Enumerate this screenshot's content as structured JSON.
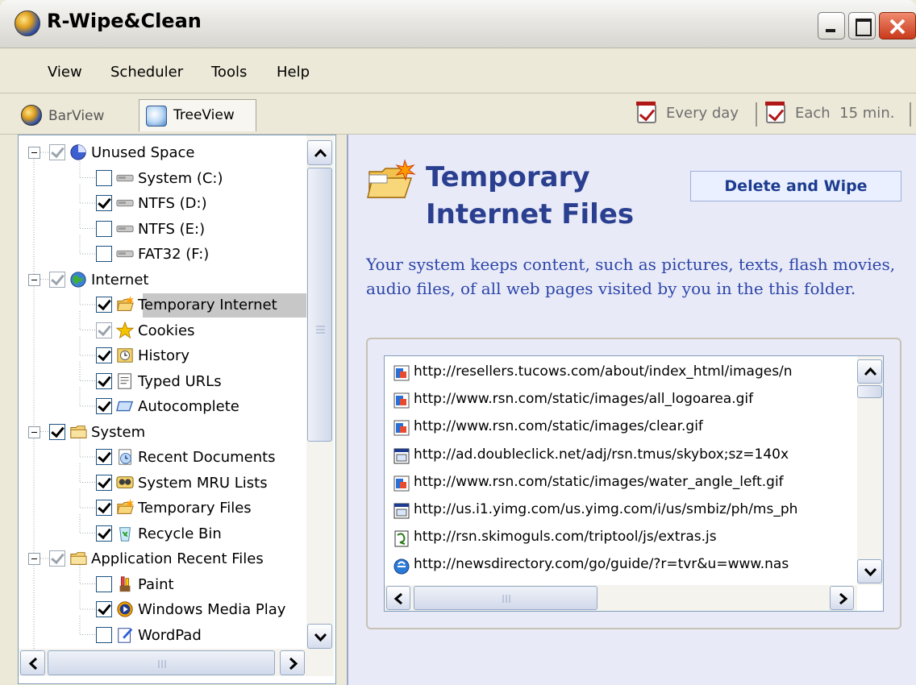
{
  "window": {
    "title": "R-Wipe&Clean"
  },
  "menu": [
    "View",
    "Scheduler",
    "Tools",
    "Help"
  ],
  "toolbar": {
    "tabs": [
      {
        "label": "BarView",
        "icon": "globe-icon",
        "active": false
      },
      {
        "label": "TreeView",
        "icon": "tree-view-icon",
        "active": true
      }
    ],
    "schedule": [
      {
        "label": "Every day",
        "icon": "calendar-check-icon"
      },
      {
        "label": "Each  15 min.",
        "icon": "calendar-check-icon"
      }
    ]
  },
  "tree": [
    {
      "label": "Unused Space",
      "level": 0,
      "checked": "partial",
      "icon": "disk-space-icon",
      "expander": true
    },
    {
      "label": "System (C:)",
      "level": 1,
      "checked": "unchecked",
      "icon": "drive-icon"
    },
    {
      "label": "NTFS (D:)",
      "level": 1,
      "checked": "checked",
      "icon": "drive-icon"
    },
    {
      "label": "NTFS (E:)",
      "level": 1,
      "checked": "unchecked",
      "icon": "drive-icon"
    },
    {
      "label": "FAT32 (F:)",
      "level": 1,
      "checked": "unchecked",
      "icon": "drive-icon"
    },
    {
      "label": "Internet",
      "level": 0,
      "checked": "partial",
      "icon": "globe-icon",
      "expander": true
    },
    {
      "label": "Temporary Internet",
      "level": 1,
      "checked": "checked",
      "icon": "folder-new-icon",
      "selected": true
    },
    {
      "label": "Cookies",
      "level": 1,
      "checked": "partial",
      "icon": "star-icon"
    },
    {
      "label": "History",
      "level": 1,
      "checked": "checked",
      "icon": "history-icon"
    },
    {
      "label": "Typed URLs",
      "level": 1,
      "checked": "checked",
      "icon": "typed-urls-icon"
    },
    {
      "label": "Autocomplete",
      "level": 1,
      "checked": "checked",
      "icon": "autocomplete-icon"
    },
    {
      "label": "System",
      "level": 0,
      "checked": "checked",
      "icon": "folder-icon",
      "expander": true
    },
    {
      "label": "Recent Documents",
      "level": 1,
      "checked": "checked",
      "icon": "recent-docs-icon"
    },
    {
      "label": "System MRU Lists",
      "level": 1,
      "checked": "checked",
      "icon": "mru-icon"
    },
    {
      "label": "Temporary Files",
      "level": 1,
      "checked": "checked",
      "icon": "folder-new-icon"
    },
    {
      "label": "Recycle Bin",
      "level": 1,
      "checked": "checked",
      "icon": "recycle-bin-icon"
    },
    {
      "label": "Application Recent Files",
      "level": 0,
      "checked": "partial",
      "icon": "folder-icon",
      "expander": true
    },
    {
      "label": "Paint",
      "level": 1,
      "checked": "unchecked",
      "icon": "paint-icon"
    },
    {
      "label": "Windows Media Play",
      "level": 1,
      "checked": "checked",
      "icon": "media-player-icon"
    },
    {
      "label": "WordPad",
      "level": 1,
      "checked": "unchecked",
      "icon": "wordpad-icon"
    }
  ],
  "details": {
    "title": "Temporary Internet Files",
    "action_button": "Delete and Wipe",
    "description": "Your system keeps content, such as pictures, texts, flash movies, audio files, of all web pages visited by you in the this folder.",
    "files": [
      {
        "url": "http://resellers.tucows.com/about/index_html/images/n",
        "icon": "image-file-icon"
      },
      {
        "url": "http://www.rsn.com/static/images/all_logoarea.gif",
        "icon": "image-file-icon"
      },
      {
        "url": "http://www.rsn.com/static/images/clear.gif",
        "icon": "image-file-icon"
      },
      {
        "url": "http://ad.doubleclick.net/adj/rsn.tmus/skybox;sz=140x",
        "icon": "web-page-icon"
      },
      {
        "url": "http://www.rsn.com/static/images/water_angle_left.gif",
        "icon": "image-file-icon"
      },
      {
        "url": "http://us.i1.yimg.com/us.yimg.com/i/us/smbiz/ph/ms_ph",
        "icon": "web-page-icon"
      },
      {
        "url": "http://rsn.skimoguls.com/triptool/js/extras.js",
        "icon": "script-file-icon"
      },
      {
        "url": "http://newsdirectory.com/go/guide/?r=tvr&u=www.nas",
        "icon": "ie-link-icon"
      }
    ]
  },
  "colors": {
    "title_blue": "#2a3f8f",
    "description_blue": "#2c45a8",
    "panel_bg": "#e8eaf8",
    "selection": "#c7c7c7"
  }
}
